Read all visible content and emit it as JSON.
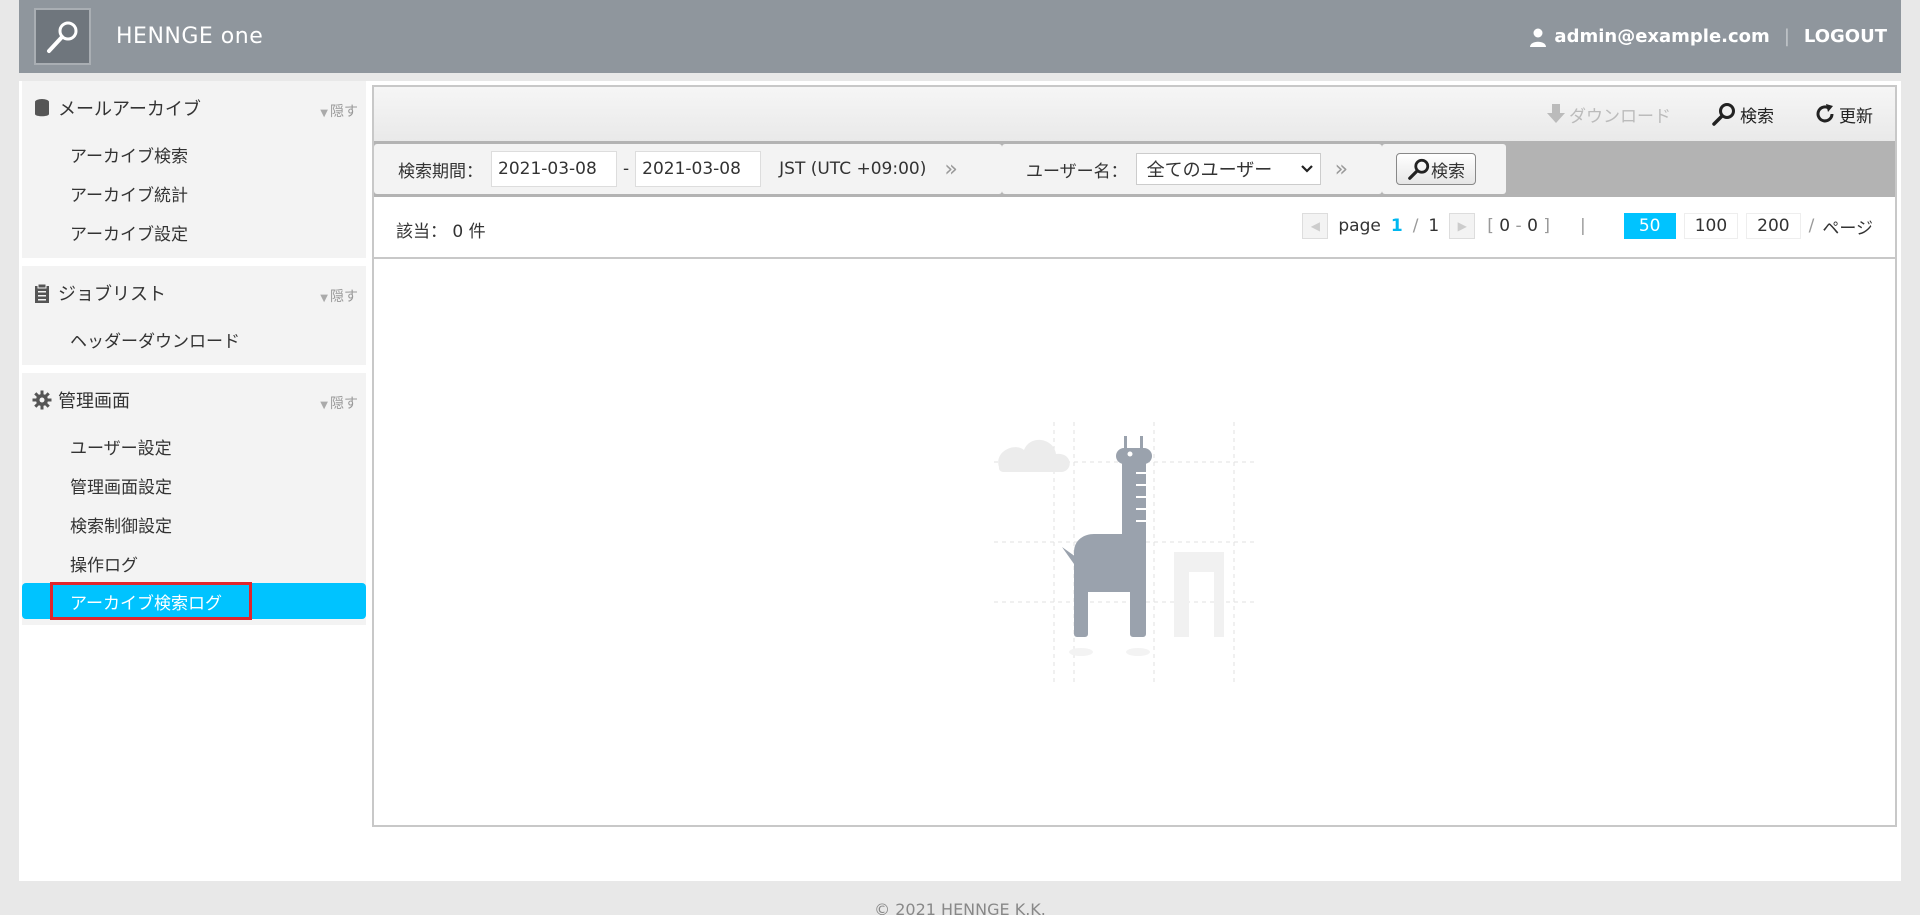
{
  "header": {
    "brand": "HENNGE one",
    "user_email": "admin@example.com",
    "separator": "|",
    "logout_label": "LOGOUT"
  },
  "sidebar": {
    "hide_label": "隠す",
    "sections": [
      {
        "title": "メールアーカイブ",
        "icon": "database-icon",
        "items": [
          "アーカイブ検索",
          "アーカイブ統計",
          "アーカイブ設定"
        ]
      },
      {
        "title": "ジョブリスト",
        "icon": "clipboard-icon",
        "items": [
          "ヘッダーダウンロード"
        ]
      },
      {
        "title": "管理画面",
        "icon": "gear-icon",
        "items": [
          "ユーザー設定",
          "管理画面設定",
          "検索制御設定",
          "操作ログ",
          "アーカイブ検索ログ"
        ],
        "active_index": 4
      }
    ]
  },
  "toolbar": {
    "download_label": "ダウンロード",
    "search_label": "検索",
    "refresh_label": "更新"
  },
  "filter": {
    "period_label": "検索期間：",
    "date_from": "2021-03-08",
    "date_to": "2021-03-08",
    "dash": "-",
    "timezone": "JST (UTC +09:00)",
    "raquo": "»",
    "username_label": "ユーザー名：",
    "username_value": "全てのユーザー",
    "search_button": "検索"
  },
  "results": {
    "count_label": "該当：",
    "count_value": "0 件",
    "page_label": "page",
    "page_current": "1",
    "page_sep": "/",
    "page_total": "1",
    "range_open": "[",
    "range_from": "0",
    "range_dash": "-",
    "range_to": "0",
    "range_close": "]",
    "pipe": "|",
    "sizes": [
      "50",
      "100",
      "200"
    ],
    "size_sep": "/",
    "per_page_label": "ページ"
  },
  "footer": {
    "copyright": "© 2021 HENNGE K.K."
  },
  "colors": {
    "header_bg": "#8f969d",
    "accent": "#00c3ff",
    "highlight_box": "#e0252b"
  }
}
